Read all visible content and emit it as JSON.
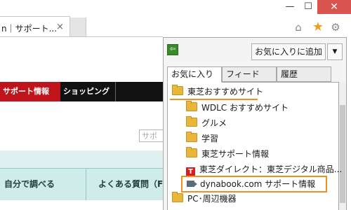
{
  "window": {
    "minimize_glyph": "—",
    "maximize_glyph": "☐",
    "close_glyph": "✕"
  },
  "browser": {
    "tab_title": "n｜サポート...",
    "tab_close_glyph": "×",
    "icons": [
      "home-icon",
      "star-icon",
      "gear-icon"
    ]
  },
  "page": {
    "nav": {
      "support_label": "サポート情報",
      "shopping_label": "ショッピング"
    },
    "search_placeholder": "サポ",
    "tiles": {
      "self_check": "自分で調べる",
      "faq": "よくある質問（F"
    }
  },
  "favorites": {
    "add_button_label": "お気に入りに追加",
    "tabs": {
      "favorites": "お気に入り",
      "feeds": "フィード",
      "history": "履歴"
    },
    "items": [
      {
        "label": "東芝おすすめサイト",
        "type": "folder"
      },
      {
        "label": "WDLC おすすめサイト",
        "type": "folder"
      },
      {
        "label": "グルメ",
        "type": "folder"
      },
      {
        "label": "学習",
        "type": "folder"
      },
      {
        "label": "東芝サポート情報",
        "type": "folder"
      },
      {
        "label": "東芝ダイレクト：東芝デジタル商品...",
        "type": "link"
      },
      {
        "label": "dynabook.com  サポート情報",
        "type": "link"
      },
      {
        "label": "PC･周辺機器",
        "type": "folder"
      }
    ]
  },
  "colors": {
    "highlight": "#f09020",
    "nav_active": "#c0141c",
    "nav_bar": "#111111",
    "tile_band": "#cfeceb",
    "close_button": "#d9534f",
    "folder": "#e8b73a"
  }
}
